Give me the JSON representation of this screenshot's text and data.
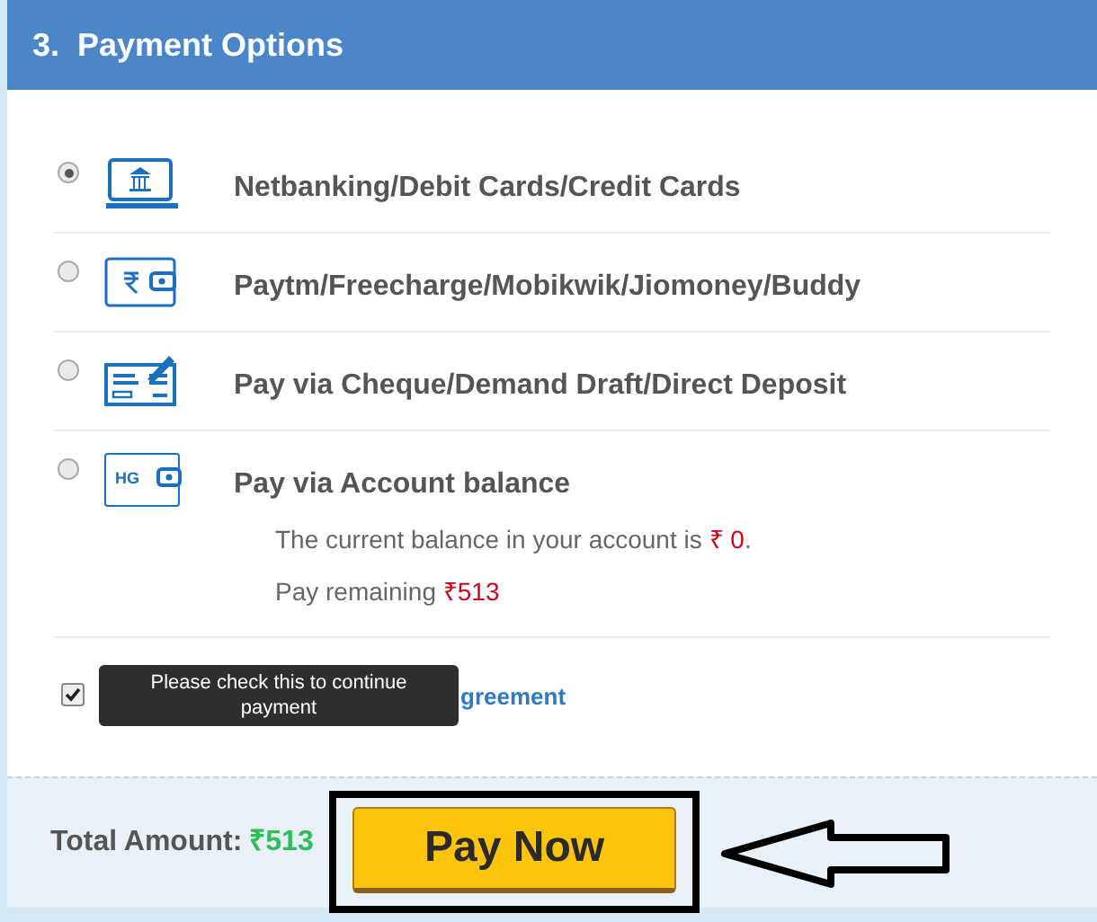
{
  "section": {
    "number": "3.",
    "title": "Payment Options"
  },
  "options": [
    {
      "kind": "bank",
      "label": "Netbanking/Debit Cards/Credit Cards",
      "selected": true
    },
    {
      "kind": "rupee",
      "label": "Paytm/Freecharge/Mobikwik/Jiomoney/Buddy",
      "selected": false
    },
    {
      "kind": "cheque",
      "label": "Pay via Cheque/Demand Draft/Direct Deposit",
      "selected": false
    },
    {
      "kind": "hg",
      "icon_text": "HG",
      "label": "Pay via Account balance",
      "selected": false,
      "details": [
        {
          "text": "The current balance in your account is ",
          "amount": "₹ 0",
          "suffix": "."
        },
        {
          "text": "Pay remaining ",
          "amount": "₹513"
        }
      ]
    }
  ],
  "agreement": {
    "checked": true,
    "visible_link_text": "greement"
  },
  "tooltip": "Please check this to continue payment",
  "footer": {
    "total_label": "Total Amount:",
    "total_value": "₹513",
    "pay_button": "Pay Now"
  }
}
